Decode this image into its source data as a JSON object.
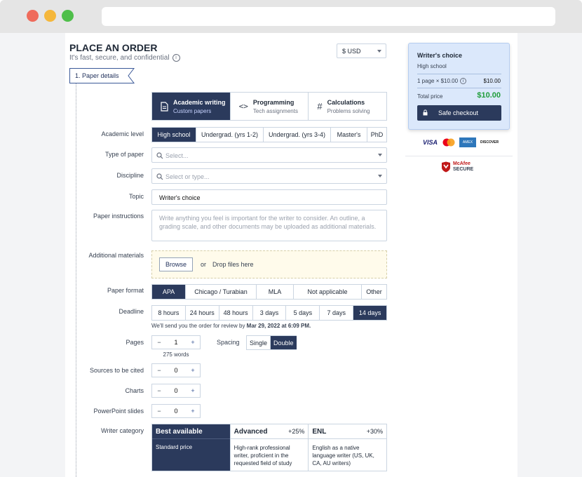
{
  "header": {
    "title": "PLACE AN ORDER",
    "subtitle": "It's fast, secure, and confidential",
    "currency": "$ USD",
    "step": "1.  Paper details"
  },
  "service_types": [
    {
      "label": "Academic writing",
      "sub": "Custom papers"
    },
    {
      "label": "Programming",
      "sub": "Tech assignments"
    },
    {
      "label": "Calculations",
      "sub": "Problems solving"
    }
  ],
  "labels": {
    "academic_level": "Academic level",
    "type_of_paper": "Type of paper",
    "discipline": "Discipline",
    "topic": "Topic",
    "instructions": "Paper instructions",
    "materials": "Additional materials",
    "format": "Paper format",
    "deadline": "Deadline",
    "pages": "Pages",
    "spacing": "Spacing",
    "sources": "Sources to be cited",
    "charts": "Charts",
    "slides": "PowerPoint slides",
    "writer": "Writer category"
  },
  "academic_levels": [
    "High school",
    "Undergrad. (yrs 1-2)",
    "Undergrad. (yrs 3-4)",
    "Master's",
    "PhD"
  ],
  "type_placeholder": "Select...",
  "discipline_placeholder": "Select or type...",
  "topic_value": "Writer's choice",
  "instructions_placeholder": "Write anything you feel is important for the writer to consider. An outline, a grading scale, and other documents may be uploaded as additional materials.",
  "materials": {
    "browse": "Browse",
    "or": "or",
    "drop": "Drop files here"
  },
  "formats": [
    "APA",
    "Chicago / Turabian",
    "MLA",
    "Not applicable",
    "Other"
  ],
  "deadlines": [
    "8 hours",
    "24 hours",
    "48 hours",
    "3 days",
    "5 days",
    "7 days",
    "14 days"
  ],
  "deadline_note_prefix": "We'll send you the order for review by ",
  "deadline_note_date": "Mar 29, 2022 at 6:09 PM.",
  "pages": {
    "minus": "−",
    "value": "1",
    "plus": "+",
    "words": "275 words"
  },
  "spacing_options": [
    "Single",
    "Double"
  ],
  "sources": {
    "value": "0"
  },
  "charts": {
    "value": "0"
  },
  "slides": {
    "value": "0"
  },
  "writers": [
    {
      "name": "Best available",
      "pct": "",
      "desc": "Standard price"
    },
    {
      "name": "Advanced",
      "pct": "+25%",
      "desc": "High-rank professional writer, proficient in the requested field of study"
    },
    {
      "name": "ENL",
      "pct": "+30%",
      "desc": "English as a native language writer (US, UK, CA, AU writers)"
    }
  ],
  "summary": {
    "title": "Writer's choice",
    "level": "High school",
    "calc": "1 page × $10.00",
    "calc_price": "$10.00",
    "total_label": "Total price",
    "total": "$10.00",
    "checkout": "Safe checkout"
  },
  "payments": [
    "VISA",
    "MC",
    "AMEX",
    "DISCOVER"
  ],
  "mcafee": {
    "line1": "McAfee",
    "line2": "SECURE"
  },
  "colors": {
    "navy": "#2b3a5c",
    "green": "#1f9d3a",
    "panel": "#dbe8fb"
  }
}
